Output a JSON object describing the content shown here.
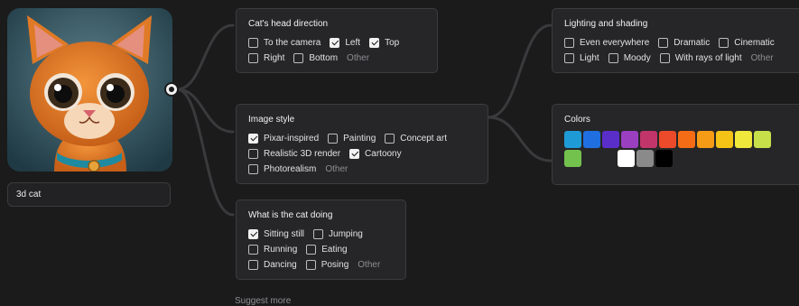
{
  "source_image": {
    "caption": "3d cat"
  },
  "cards": {
    "head_direction": {
      "title": "Cat's head direction",
      "rows": [
        [
          {
            "label": "To the camera",
            "checked": false
          },
          {
            "label": "Left",
            "checked": true
          },
          {
            "label": "Top",
            "checked": true
          }
        ],
        [
          {
            "label": "Right",
            "checked": false
          },
          {
            "label": "Bottom",
            "checked": false
          }
        ]
      ],
      "other": "Other"
    },
    "image_style": {
      "title": "Image style",
      "rows": [
        [
          {
            "label": "Pixar-inspired",
            "checked": true
          },
          {
            "label": "Painting",
            "checked": false
          },
          {
            "label": "Concept art",
            "checked": false
          }
        ],
        [
          {
            "label": "Realistic 3D render",
            "checked": false
          },
          {
            "label": "Cartoony",
            "checked": true
          }
        ],
        [
          {
            "label": "Photorealism",
            "checked": false
          }
        ]
      ],
      "other": "Other"
    },
    "activity": {
      "title": "What is the cat doing",
      "rows": [
        [
          {
            "label": "Sitting still",
            "checked": true
          },
          {
            "label": "Jumping",
            "checked": false
          }
        ],
        [
          {
            "label": "Running",
            "checked": false
          },
          {
            "label": "Eating",
            "checked": false
          }
        ],
        [
          {
            "label": "Dancing",
            "checked": false
          },
          {
            "label": "Posing",
            "checked": false
          }
        ]
      ],
      "other": "Other"
    },
    "lighting": {
      "title": "Lighting and shading",
      "rows": [
        [
          {
            "label": "Even everywhere",
            "checked": false
          },
          {
            "label": "Dramatic",
            "checked": false
          },
          {
            "label": "Cinematic",
            "checked": false
          }
        ],
        [
          {
            "label": "Light",
            "checked": false
          },
          {
            "label": "Moody",
            "checked": false
          },
          {
            "label": "With rays of light",
            "checked": false
          }
        ]
      ],
      "other": "Other"
    },
    "colors": {
      "title": "Colors",
      "swatches": [
        "#1e9bd7",
        "#1f6fe0",
        "#5a2ec9",
        "#9b3fc1",
        "#c2356a",
        "#ec4b2b",
        "#f56c17",
        "#f59b16",
        "#f5c316",
        "#f1e83c",
        "#c7e04a",
        "#73c24e",
        "#ffffff",
        "#8a8a8a",
        "#000000"
      ]
    }
  },
  "suggest_more": "Suggest more"
}
